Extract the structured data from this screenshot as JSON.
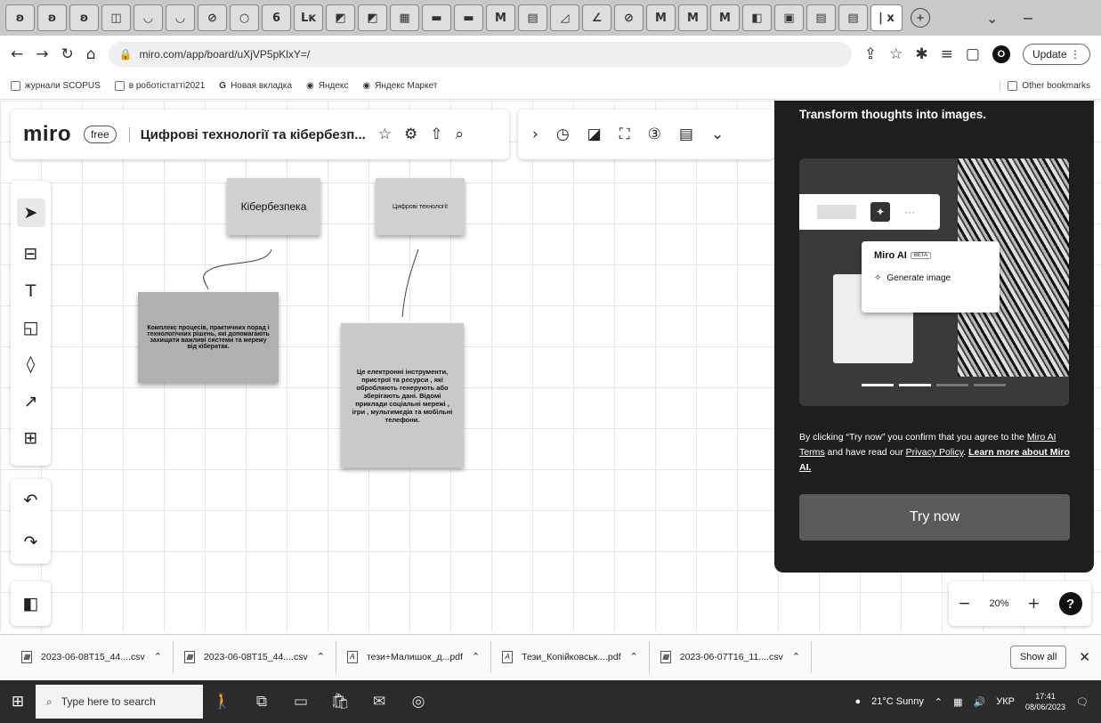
{
  "browser": {
    "tab_icons": [
      "ʚ",
      "ʚ",
      "ʚ",
      "◫",
      "◡",
      "◡",
      "⊘",
      "○",
      "6",
      "Lᴋ",
      "◩",
      "◩",
      "▦",
      "▬",
      "▬",
      "M",
      "▤",
      "◿",
      "∠",
      "⊘",
      "M",
      "M",
      "M",
      "◧",
      "▣",
      "▤",
      "▤"
    ],
    "active_tab_label": "| x",
    "new_tab": "+",
    "url": "miro.com/app/board/uXjVP5pKlxY=/",
    "update_label": "Update",
    "profile_initial": "O",
    "bookmarks": [
      "журнали SCOPUS",
      "в роботістатті2021",
      "Новая вкладка",
      "Яндекс",
      "Яндекс Маркет"
    ],
    "other_bookmarks": "Other bookmarks"
  },
  "miro": {
    "logo": "miro",
    "plan_badge": "free",
    "board_title": "Цифрові технології та кібербезп...",
    "stickies": {
      "cyber_title": "Кібербезпека",
      "digital_title": "Цифрові технології",
      "cyber_def": "Комплекс процесів, практичних порад і технологічних рішень, які допомагають захищати важливі системи та мережу від кібератак.",
      "digital_def": "Це електронні інструменти, пристрої та ресурси , які обробляють генерують або зберігають дані. Відомі приклади соціальні мережі , ігри , мультимедіа та мобільні телефони."
    },
    "ai_popup": {
      "heading": "Transform thoughts into images.",
      "menu_title": "Miro AI",
      "beta": "BETA",
      "menu_item": "Generate image",
      "consent_1": "By clicking “Try now” you confirm that you agree to the ",
      "terms_link": "Miro AI Terms",
      "consent_2": " and have read our ",
      "privacy_link": "Privacy Policy",
      "consent_3": ". ",
      "learn_link": "Learn more about Miro AI.",
      "try_button": "Try now"
    },
    "zoom": {
      "minus": "−",
      "level": "20%",
      "plus": "+",
      "help": "?"
    }
  },
  "downloads": {
    "items": [
      "2023-06-08T15_44....csv",
      "2023-06-08T15_44....csv",
      "тези+Малишок_д...pdf",
      "Тези_Копійковськ....pdf",
      "2023-06-07T16_11....csv"
    ],
    "show_all": "Show all",
    "close": "✕"
  },
  "taskbar": {
    "search_placeholder": "Type here to search",
    "weather": "21°C Sunny",
    "lang": "УКР",
    "time": "17:41",
    "date": "08/06/2023"
  }
}
